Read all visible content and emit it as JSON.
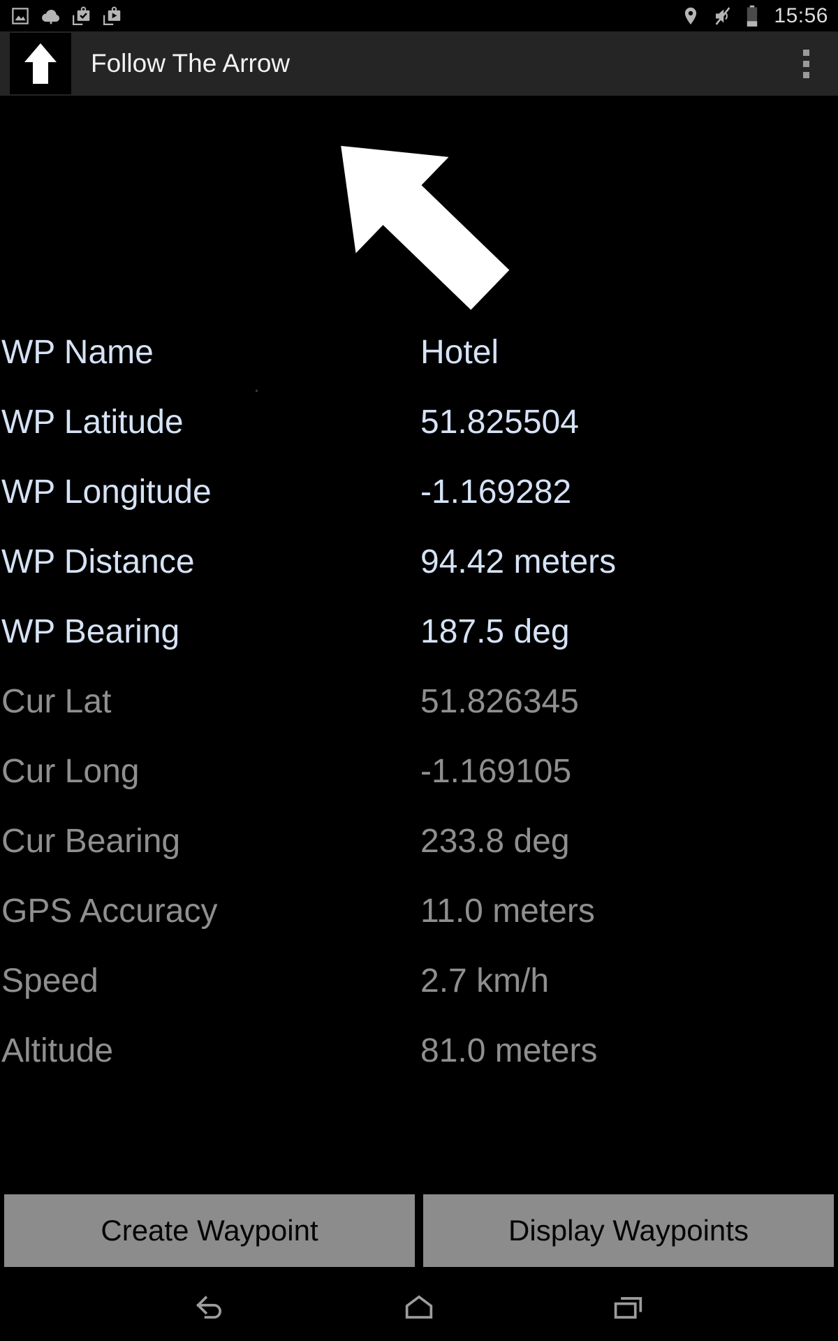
{
  "status_bar": {
    "icons_left": [
      "image-icon",
      "cloud-upload-icon",
      "screenshot-check-icon",
      "screen-record-icon"
    ],
    "icons_right": [
      "location-pin-icon",
      "volume-muted-icon",
      "battery-icon"
    ],
    "time": "15:56"
  },
  "app_bar": {
    "icon": "up-arrow-app-icon",
    "title": "Follow The Arrow",
    "overflow": "overflow-menu-icon"
  },
  "compass": {
    "arrow_icon": "navigation-arrow-northwest",
    "direction_deg": -46
  },
  "readouts": [
    {
      "group": "wp",
      "label": "WP Name",
      "value": "Hotel"
    },
    {
      "group": "wp",
      "label": "WP Latitude",
      "value": "51.825504"
    },
    {
      "group": "wp",
      "label": "WP Longitude",
      "value": "-1.169282"
    },
    {
      "group": "wp",
      "label": "WP Distance",
      "value": "94.42 meters"
    },
    {
      "group": "wp",
      "label": "WP Bearing",
      "value": "187.5 deg"
    },
    {
      "group": "cur",
      "label": "Cur Lat",
      "value": "51.826345"
    },
    {
      "group": "cur",
      "label": "Cur Long",
      "value": "-1.169105"
    },
    {
      "group": "cur",
      "label": "Cur Bearing",
      "value": "233.8 deg"
    },
    {
      "group": "cur",
      "label": "GPS Accuracy",
      "value": "11.0 meters"
    },
    {
      "group": "cur",
      "label": "Speed",
      "value": "2.7 km/h"
    },
    {
      "group": "cur",
      "label": "Altitude",
      "value": "81.0 meters"
    }
  ],
  "buttons": {
    "create": "Create Waypoint",
    "display": "Display Waypoints"
  },
  "nav_bar": {
    "back": "back-icon",
    "home": "home-icon",
    "recents": "recents-icon"
  },
  "colors": {
    "background": "#000000",
    "app_bar": "#252525",
    "wp_text": "#d6e2f5",
    "cur_text": "#8f8f8f",
    "button_bg": "#8c8c8c",
    "button_text": "#050505",
    "status_icon": "#b5b5b5"
  }
}
